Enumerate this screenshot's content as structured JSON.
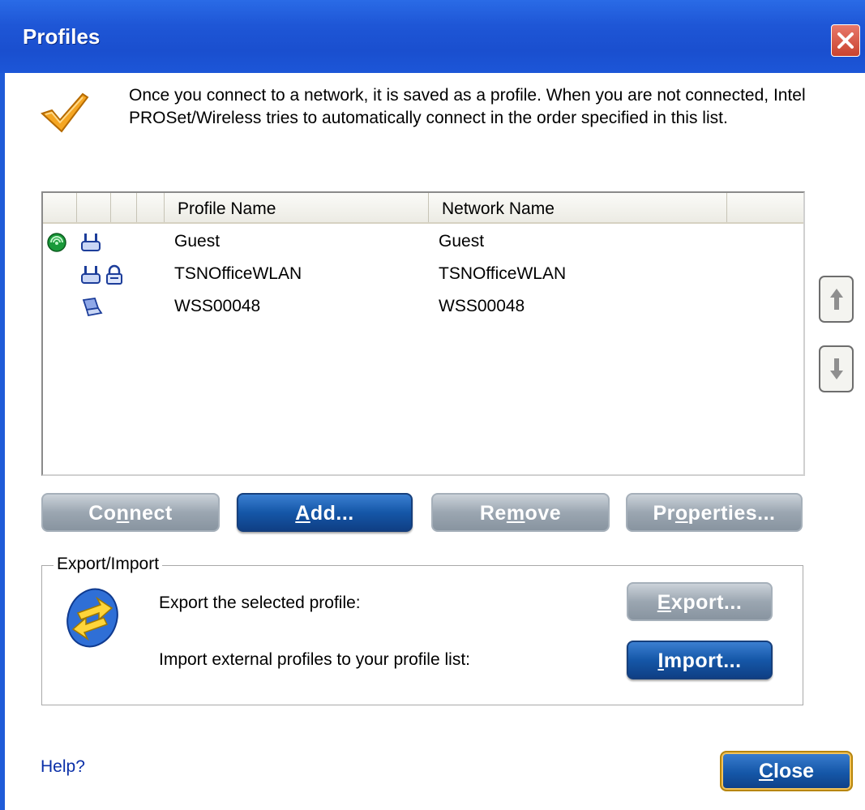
{
  "window": {
    "title": "Profiles"
  },
  "intro": {
    "text": "Once you connect to a network, it is saved as a profile. When you are not connected, Intel PROSet/Wireless tries to automatically connect in the order specified in this list."
  },
  "profiles_list": {
    "columns": [
      "Profile Name",
      "Network Name"
    ],
    "rows": [
      {
        "profile_name": "Guest",
        "network_name": "Guest",
        "icons": [
          "connected-globe-icon",
          "access-point-icon"
        ]
      },
      {
        "profile_name": "TSNOfficeWLAN",
        "network_name": "TSNOfficeWLAN",
        "icons": [
          "access-point-icon",
          "lock-icon"
        ]
      },
      {
        "profile_name": "WSS00048",
        "network_name": "WSS00048",
        "icons": [
          "adhoc-laptop-icon"
        ]
      }
    ]
  },
  "buttons": {
    "connect": {
      "pre": "Co",
      "ul": "n",
      "post": "nect"
    },
    "add": {
      "pre": "",
      "ul": "A",
      "post": "dd..."
    },
    "remove": {
      "pre": "Re",
      "ul": "m",
      "post": "ove"
    },
    "properties": {
      "pre": "Pr",
      "ul": "o",
      "post": "perties..."
    }
  },
  "export_import": {
    "legend": "Export/Import",
    "export_text": "Export the selected profile:",
    "import_text": "Import external profiles to your profile list:",
    "export_button": {
      "pre": "",
      "ul": "E",
      "post": "xport..."
    },
    "import_button": {
      "pre": "",
      "ul": "I",
      "post": "mport..."
    }
  },
  "footer": {
    "help": "Help?",
    "close_button": {
      "pre": "",
      "ul": "C",
      "post": "lose"
    }
  },
  "colors": {
    "title_bar": "#1e56d6",
    "blue_button": "#1557a8",
    "gray_button": "#9ba6b1",
    "help_link": "#0a2fa8"
  }
}
